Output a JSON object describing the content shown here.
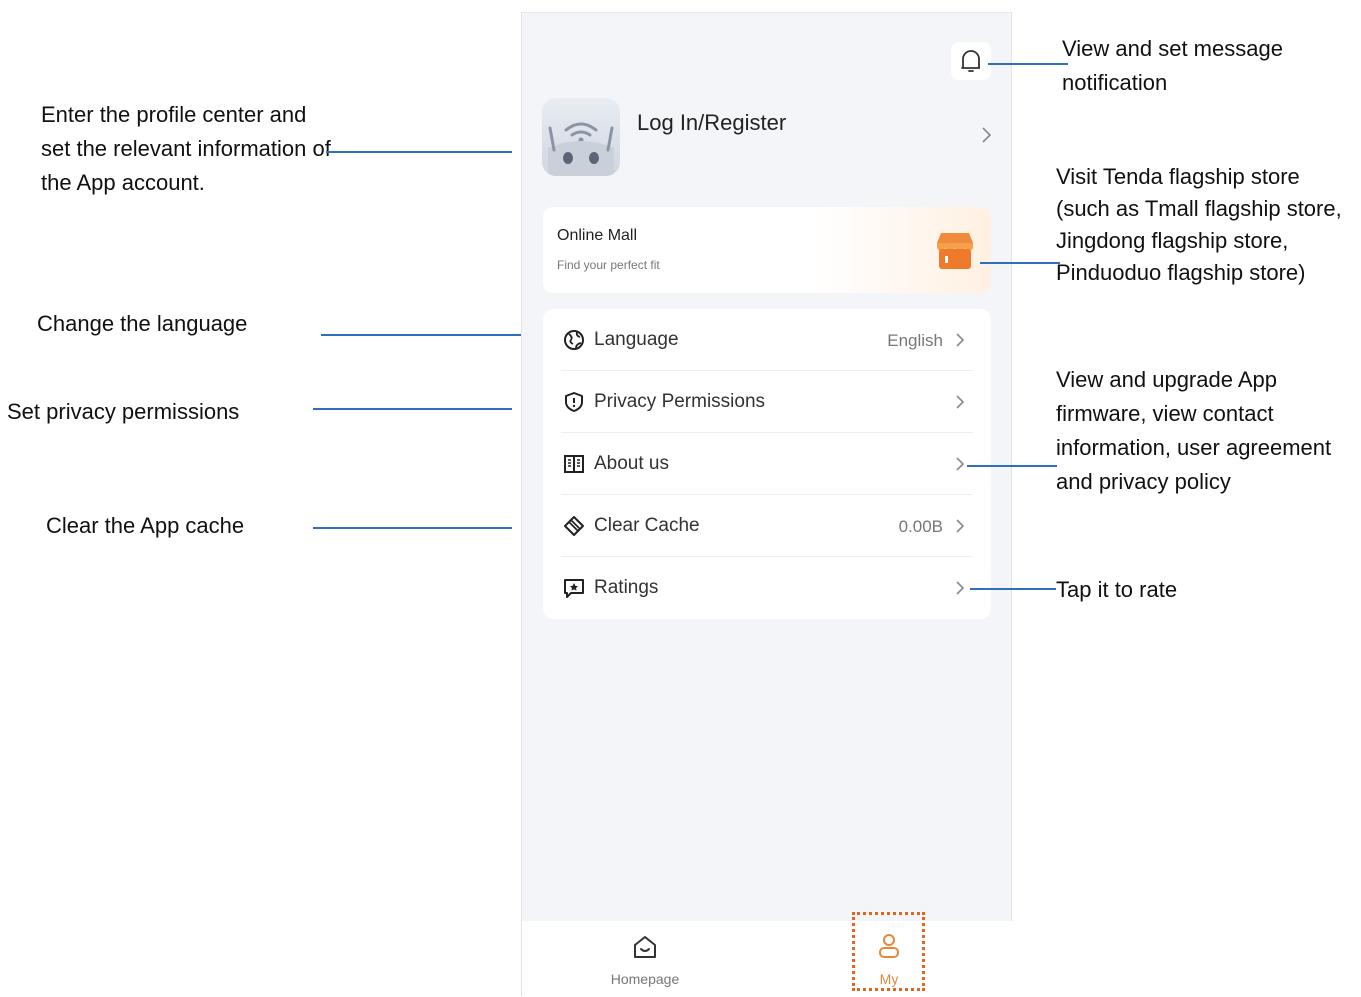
{
  "header": {
    "bell_icon": "bell-icon"
  },
  "profile": {
    "login_label": "Log In/Register"
  },
  "mall": {
    "title": "Online Mall",
    "subtitle": "Find your perfect fit",
    "icon": "store-icon"
  },
  "menu": {
    "items": [
      {
        "label": "Language",
        "value": "English",
        "icon": "globe-icon"
      },
      {
        "label": "Privacy Permissions",
        "value": "",
        "icon": "shield-icon"
      },
      {
        "label": "About us",
        "value": "",
        "icon": "book-icon"
      },
      {
        "label": "Clear Cache",
        "value": "0.00B",
        "icon": "eraser-icon"
      },
      {
        "label": "Ratings",
        "value": "",
        "icon": "rating-star-icon"
      }
    ]
  },
  "tabbar": {
    "tabs": [
      {
        "label": "Homepage",
        "icon": "home-icon"
      },
      {
        "label": "My",
        "icon": "user-icon"
      }
    ],
    "active_color": "#e5883b"
  },
  "annotations": {
    "profile": "Enter the profile center and set the relevant information of the App account.",
    "language": "Change the language",
    "privacy": "Set privacy permissions",
    "cache": "Clear the App cache",
    "notification": "View and set message notification",
    "store": "Visit Tenda flagship store (such as Tmall flagship store, Jingdong flagship store, Pinduoduo flagship store)",
    "about": "View and upgrade App firmware, view contact information, user agreement and privacy policy",
    "rate": "Tap it to rate"
  }
}
